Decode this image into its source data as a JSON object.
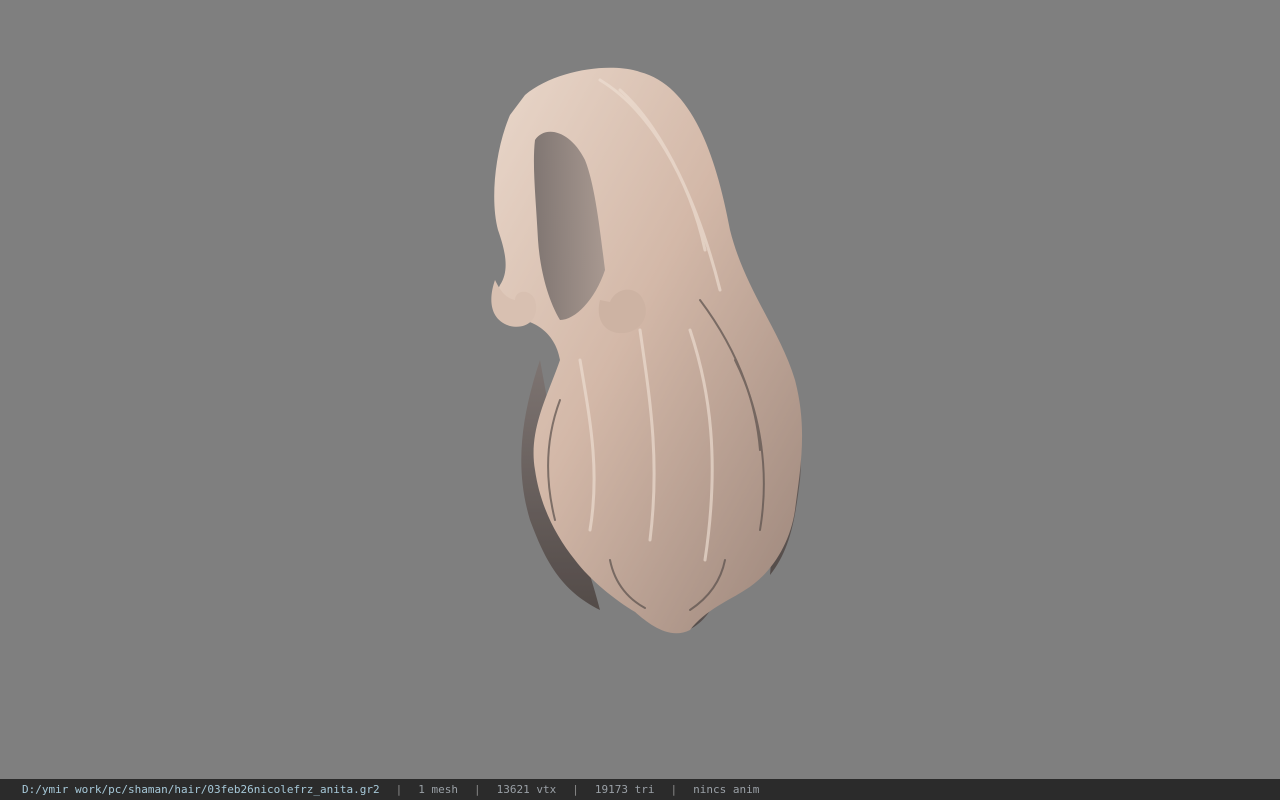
{
  "viewport": {
    "background_color": "#7f7f7f",
    "model_icon": "hair-mesh-render",
    "model_colors": {
      "highlight": "#e6d2c4",
      "mid": "#c9ad9c",
      "shadow": "#5e5450",
      "scalp": "#8c8381"
    }
  },
  "statusbar": {
    "file_path": "D:/ymir work/pc/shaman/hair/03feb26nicolefrz_anita.gr2",
    "separator": "|",
    "mesh_count": "1 mesh",
    "vertex_count": "13621 vtx",
    "triangle_count": "19173 tri",
    "anim_status": "nincs anim"
  }
}
